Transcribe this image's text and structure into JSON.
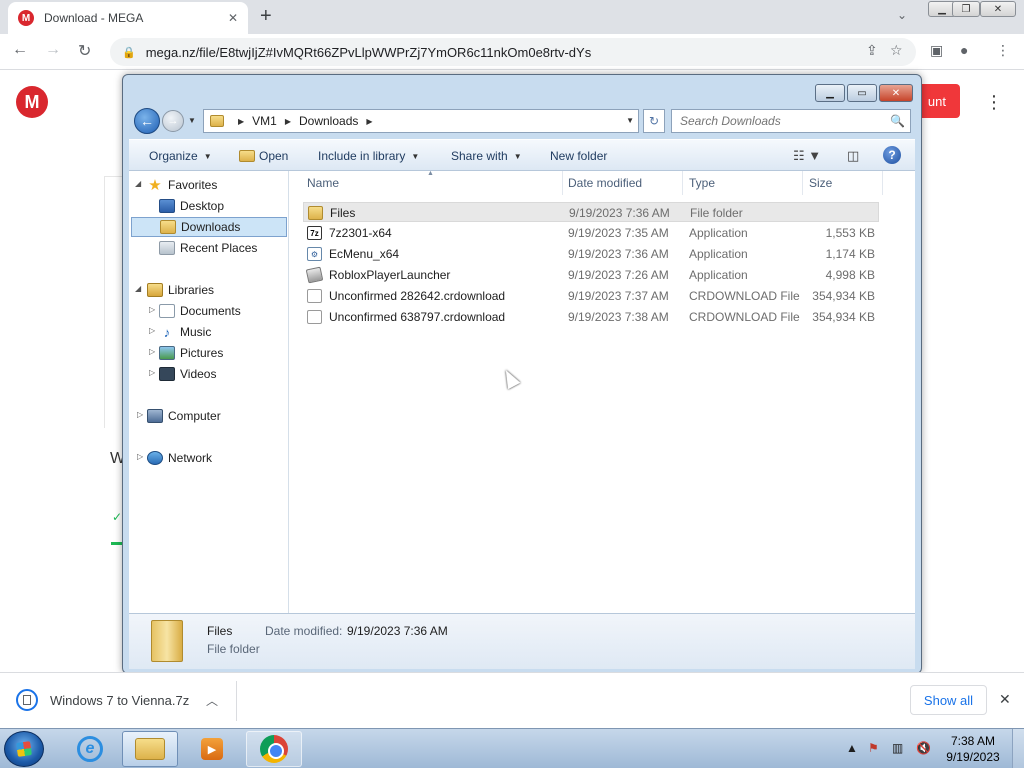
{
  "browser": {
    "tab_title": "Download - MEGA",
    "url": "mega.nz/file/E8twjIjZ#IvMQRt66ZPvLlpWWPrZj7YmOR6c11nkOm0e8rtv-dYs"
  },
  "page": {
    "account_btn": "unt",
    "partial_heading": "W"
  },
  "explorer": {
    "breadcrumb": [
      "VM1",
      "Downloads"
    ],
    "search_placeholder": "Search Downloads",
    "commands": {
      "organize": "Organize",
      "open": "Open",
      "include": "Include in library",
      "share": "Share with",
      "new_folder": "New folder"
    },
    "nav": {
      "favorites": "Favorites",
      "desktop": "Desktop",
      "downloads": "Downloads",
      "recent": "Recent Places",
      "libraries": "Libraries",
      "documents": "Documents",
      "music": "Music",
      "pictures": "Pictures",
      "videos": "Videos",
      "computer": "Computer",
      "network": "Network"
    },
    "columns": {
      "name": "Name",
      "date": "Date modified",
      "type": "Type",
      "size": "Size"
    },
    "files": [
      {
        "name": "Files",
        "date": "9/19/2023 7:36 AM",
        "type": "File folder",
        "size": ""
      },
      {
        "name": "7z2301-x64",
        "date": "9/19/2023 7:35 AM",
        "type": "Application",
        "size": "1,553 KB"
      },
      {
        "name": "EcMenu_x64",
        "date": "9/19/2023 7:36 AM",
        "type": "Application",
        "size": "1,174 KB"
      },
      {
        "name": "RobloxPlayerLauncher",
        "date": "9/19/2023 7:26 AM",
        "type": "Application",
        "size": "4,998 KB"
      },
      {
        "name": "Unconfirmed 282642.crdownload",
        "date": "9/19/2023 7:37 AM",
        "type": "CRDOWNLOAD File",
        "size": "354,934 KB"
      },
      {
        "name": "Unconfirmed 638797.crdownload",
        "date": "9/19/2023 7:38 AM",
        "type": "CRDOWNLOAD File",
        "size": "354,934 KB"
      }
    ],
    "details": {
      "name": "Files",
      "type": "File folder",
      "date_label": "Date modified:",
      "date_value": "9/19/2023 7:36 AM"
    }
  },
  "download_shelf": {
    "file_name": "Windows 7 to Vienna.7z",
    "show_all": "Show all"
  },
  "taskbar": {
    "time": "7:38 AM",
    "date": "9/19/2023"
  },
  "colors": {
    "mega_red": "#d9272e",
    "selection_blue": "#cce4f7",
    "chrome_blue": "#1a73e8"
  }
}
